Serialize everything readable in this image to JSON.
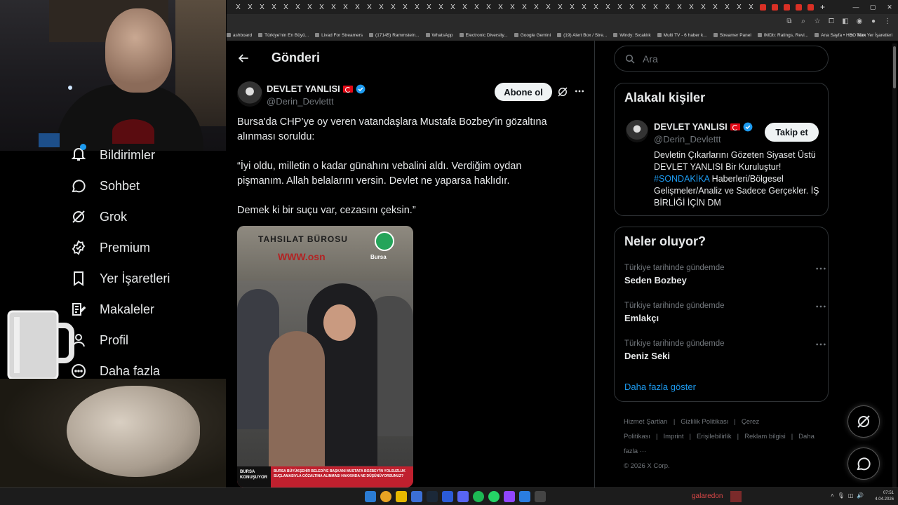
{
  "browser": {
    "tab_close_glyph": "X",
    "tab_count_plain": 44,
    "tab_count_red": 5,
    "new_tab_glyph": "+",
    "bookmarks": [
      "ashboard",
      "Türkiye'nin En Büyü...",
      "Livad For Streamers",
      "(17145) Rammstein...",
      "WhatsApp",
      "Electronic Diversity...",
      "Google Gemini",
      "(19) Alert Box / Stre...",
      "Windy: Sıcaklık",
      "Multi TV - 6 haber k...",
      "Streamer Panel",
      "IMDb: Ratings, Revi...",
      "Ana Sayfa • HBO Max"
    ],
    "bookmarks_all": "Tüm Yer İşaretleri"
  },
  "nav": {
    "items": [
      {
        "label": "Bildirimler",
        "icon": "bell-icon"
      },
      {
        "label": "Sohbet",
        "icon": "chat-icon"
      },
      {
        "label": "Grok",
        "icon": "grok-icon"
      },
      {
        "label": "Premium",
        "icon": "premium-icon"
      },
      {
        "label": "Yer İşaretleri",
        "icon": "bookmark-icon"
      },
      {
        "label": "Makaleler",
        "icon": "article-icon"
      },
      {
        "label": "Profil",
        "icon": "profile-icon"
      },
      {
        "label": "Daha fazla",
        "icon": "more-circle-icon"
      }
    ]
  },
  "post": {
    "page_title": "Gönderi",
    "author_name": "DEVLET YANLISI",
    "author_handle": "@Derin_Devlettt",
    "follow_label": "Abone ol",
    "paragraphs": [
      "Bursa'da CHP’ye oy veren vatandaşlara Mustafa Bozbey'in gözaltına alınması soruldu:",
      "“İyi oldu, milletin o kadar günahını vebalini aldı. Verdiğim oydan pişmanım. Allah belalarını versin. Devlet ne yaparsa haklıdır.",
      "Demek ki bir suçu var, cezasını çeksin.”"
    ],
    "media": {
      "sign_text": "TAHSILAT BÜROSU",
      "sign_red": "WWW.osn",
      "logo_text": "Bursa",
      "banner_left": "BURSA KONUŞUYOR",
      "banner_text": "BURSA BÜYÜKŞEHİR BELEDİYE BAŞKANI MUSTAFA BOZBEY'İN YOLSUZLUK SUÇLAMASIYLA GÖZALTINA ALINMASI HAKKINDA NE DÜŞÜNÜYORSUNUZ?"
    }
  },
  "sidebar": {
    "search_placeholder": "Ara",
    "related_title": "Alakalı kişiler",
    "related": {
      "name": "DEVLET YANLISI",
      "handle": "@Derin_Devlettt",
      "follow_label": "Takip et",
      "bio_before": "Devletin Çıkarlarını Gözeten Siyaset Üstü DEVLET YANLISI Bir Kuruluştur! ",
      "bio_tag": "#SONDAKİKA",
      "bio_after": " Haberleri/Bölgesel Gelişmeler/Analiz ve Sadece Gerçekler. İŞ BİRLİĞİ İÇİN DM"
    },
    "trends_title": "Neler oluyor?",
    "trends": [
      {
        "context": "Türkiye tarihinde gündemde",
        "name": "Seden Bozbey"
      },
      {
        "context": "Türkiye tarihinde gündemde",
        "name": "Emlakçı"
      },
      {
        "context": "Türkiye tarihinde gündemde",
        "name": "Deniz Seki"
      }
    ],
    "show_more": "Daha fazla göster",
    "footer_links": [
      "Hizmet Şartları",
      "|",
      "Gizlilik Politikası",
      "|",
      "Çerez Politikası",
      "|",
      "Imprint",
      "|",
      "Erişilebilirlik",
      "|",
      "Reklam bilgisi",
      "|",
      "Daha fazla ···"
    ],
    "copyright": "© 2026 X Corp."
  },
  "taskbar": {
    "user": "galaredon",
    "time": "07:51",
    "date": "4.04.2026"
  },
  "colors": {
    "accent": "#1d9bf0",
    "text": "#e7e9ea",
    "muted": "#71767b",
    "border": "#2f3336"
  }
}
